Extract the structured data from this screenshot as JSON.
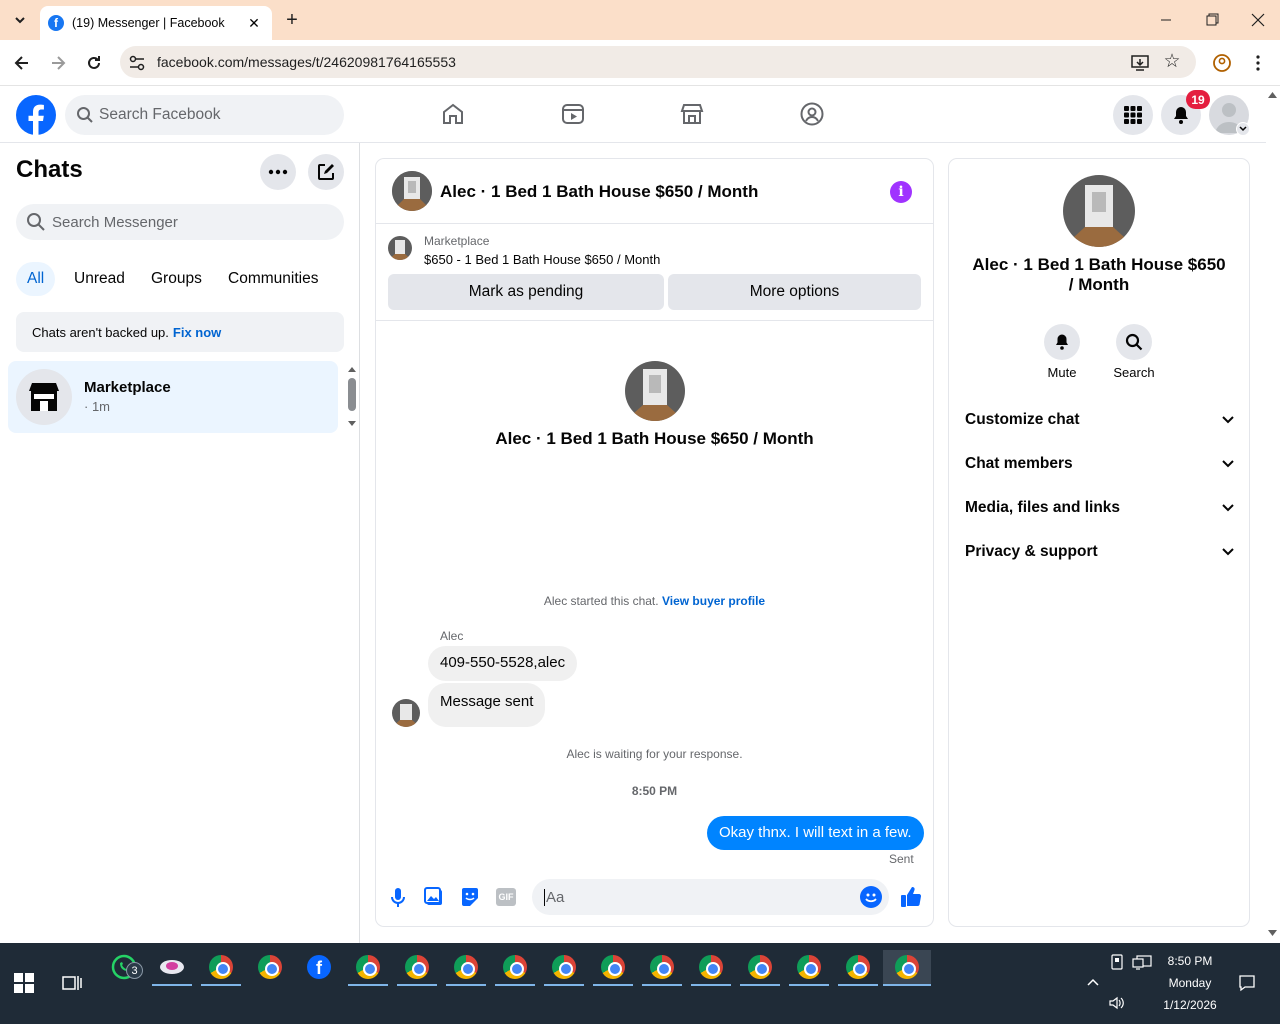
{
  "browser": {
    "tab_title": "(19) Messenger | Facebook",
    "url": "facebook.com/messages/t/24620981764165553"
  },
  "fb": {
    "search_placeholder": "Search Facebook",
    "notification_count": "19",
    "brand_color": "#0866ff"
  },
  "sidebar": {
    "title": "Chats",
    "search_placeholder": "Search Messenger",
    "filters": [
      "All",
      "Unread",
      "Groups",
      "Communities"
    ],
    "backup_text": "Chats aren't backed up.",
    "backup_link": "Fix now",
    "chat": {
      "name": "Marketplace",
      "meta": "· 1m"
    }
  },
  "conversation": {
    "title": "Alec · 1 Bed 1 Bath House $650 / Month",
    "listing_source": "Marketplace",
    "listing_title": "$650 - 1 Bed 1 Bath House $650 / Month",
    "mark_pending": "Mark as pending",
    "more_options": "More options",
    "intro_name": "Alec · 1 Bed 1 Bath House $650 / Month",
    "started_text": "Alec started this chat.",
    "view_profile": "View buyer profile",
    "sender": "Alec",
    "messages_in": [
      "409-550-5528,alec",
      "Message sent"
    ],
    "waiting_text": "Alec is waiting for your response.",
    "timestamp": "8:50 PM",
    "message_out": "Okay thnx. I will text in a few.",
    "sent_status": "Sent",
    "composer_placeholder": "Aa"
  },
  "details": {
    "name": "Alec · 1 Bed 1 Bath House $650 / Month",
    "mute": "Mute",
    "search": "Search",
    "sections": [
      "Customize chat",
      "Chat members",
      "Media, files and links",
      "Privacy & support"
    ]
  },
  "taskbar": {
    "time": "8:50 PM",
    "day": "Monday",
    "date": "1/12/2026",
    "whatsapp_badge": "3"
  }
}
